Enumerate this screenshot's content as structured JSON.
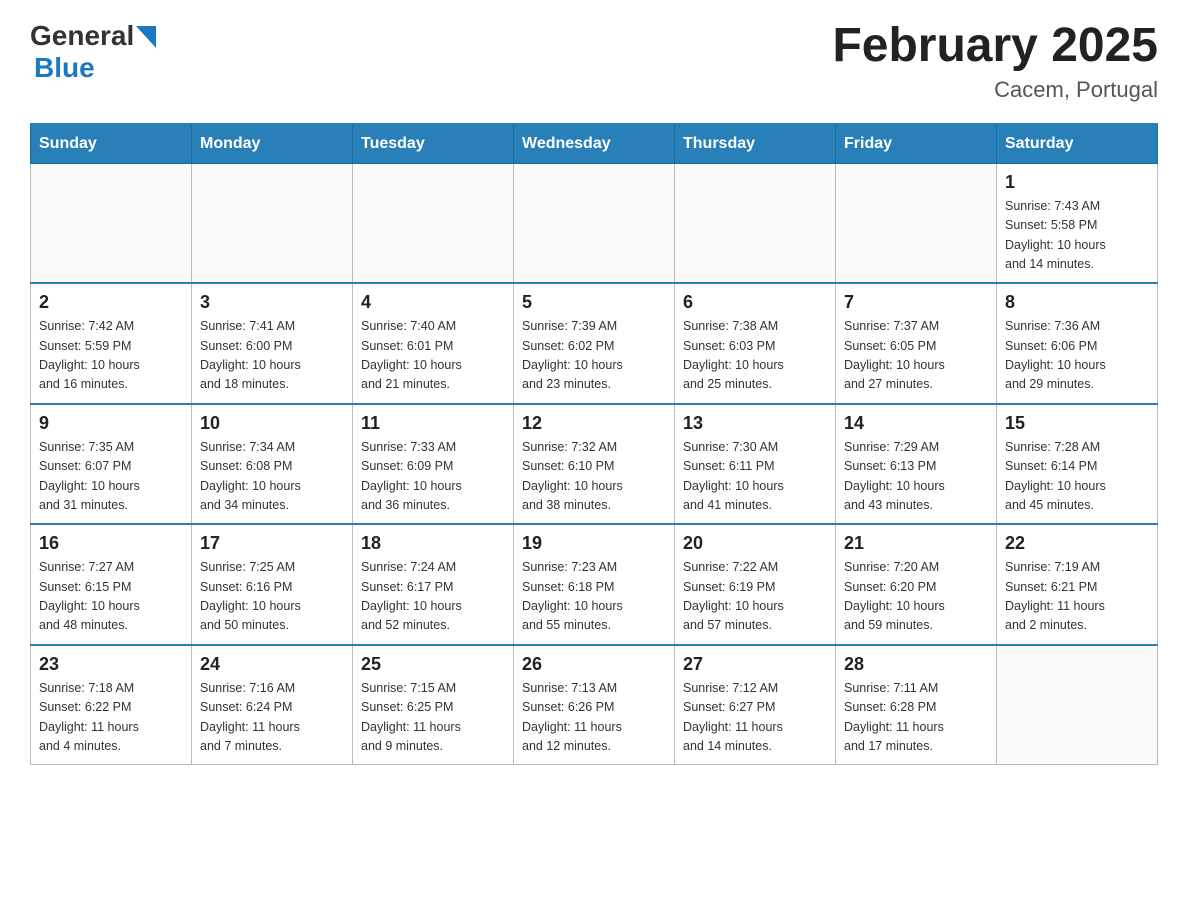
{
  "header": {
    "logo_general": "General",
    "logo_blue": "Blue",
    "month_title": "February 2025",
    "location": "Cacem, Portugal"
  },
  "days_of_week": [
    "Sunday",
    "Monday",
    "Tuesday",
    "Wednesday",
    "Thursday",
    "Friday",
    "Saturday"
  ],
  "weeks": [
    [
      {
        "day": "",
        "info": ""
      },
      {
        "day": "",
        "info": ""
      },
      {
        "day": "",
        "info": ""
      },
      {
        "day": "",
        "info": ""
      },
      {
        "day": "",
        "info": ""
      },
      {
        "day": "",
        "info": ""
      },
      {
        "day": "1",
        "info": "Sunrise: 7:43 AM\nSunset: 5:58 PM\nDaylight: 10 hours\nand 14 minutes."
      }
    ],
    [
      {
        "day": "2",
        "info": "Sunrise: 7:42 AM\nSunset: 5:59 PM\nDaylight: 10 hours\nand 16 minutes."
      },
      {
        "day": "3",
        "info": "Sunrise: 7:41 AM\nSunset: 6:00 PM\nDaylight: 10 hours\nand 18 minutes."
      },
      {
        "day": "4",
        "info": "Sunrise: 7:40 AM\nSunset: 6:01 PM\nDaylight: 10 hours\nand 21 minutes."
      },
      {
        "day": "5",
        "info": "Sunrise: 7:39 AM\nSunset: 6:02 PM\nDaylight: 10 hours\nand 23 minutes."
      },
      {
        "day": "6",
        "info": "Sunrise: 7:38 AM\nSunset: 6:03 PM\nDaylight: 10 hours\nand 25 minutes."
      },
      {
        "day": "7",
        "info": "Sunrise: 7:37 AM\nSunset: 6:05 PM\nDaylight: 10 hours\nand 27 minutes."
      },
      {
        "day": "8",
        "info": "Sunrise: 7:36 AM\nSunset: 6:06 PM\nDaylight: 10 hours\nand 29 minutes."
      }
    ],
    [
      {
        "day": "9",
        "info": "Sunrise: 7:35 AM\nSunset: 6:07 PM\nDaylight: 10 hours\nand 31 minutes."
      },
      {
        "day": "10",
        "info": "Sunrise: 7:34 AM\nSunset: 6:08 PM\nDaylight: 10 hours\nand 34 minutes."
      },
      {
        "day": "11",
        "info": "Sunrise: 7:33 AM\nSunset: 6:09 PM\nDaylight: 10 hours\nand 36 minutes."
      },
      {
        "day": "12",
        "info": "Sunrise: 7:32 AM\nSunset: 6:10 PM\nDaylight: 10 hours\nand 38 minutes."
      },
      {
        "day": "13",
        "info": "Sunrise: 7:30 AM\nSunset: 6:11 PM\nDaylight: 10 hours\nand 41 minutes."
      },
      {
        "day": "14",
        "info": "Sunrise: 7:29 AM\nSunset: 6:13 PM\nDaylight: 10 hours\nand 43 minutes."
      },
      {
        "day": "15",
        "info": "Sunrise: 7:28 AM\nSunset: 6:14 PM\nDaylight: 10 hours\nand 45 minutes."
      }
    ],
    [
      {
        "day": "16",
        "info": "Sunrise: 7:27 AM\nSunset: 6:15 PM\nDaylight: 10 hours\nand 48 minutes."
      },
      {
        "day": "17",
        "info": "Sunrise: 7:25 AM\nSunset: 6:16 PM\nDaylight: 10 hours\nand 50 minutes."
      },
      {
        "day": "18",
        "info": "Sunrise: 7:24 AM\nSunset: 6:17 PM\nDaylight: 10 hours\nand 52 minutes."
      },
      {
        "day": "19",
        "info": "Sunrise: 7:23 AM\nSunset: 6:18 PM\nDaylight: 10 hours\nand 55 minutes."
      },
      {
        "day": "20",
        "info": "Sunrise: 7:22 AM\nSunset: 6:19 PM\nDaylight: 10 hours\nand 57 minutes."
      },
      {
        "day": "21",
        "info": "Sunrise: 7:20 AM\nSunset: 6:20 PM\nDaylight: 10 hours\nand 59 minutes."
      },
      {
        "day": "22",
        "info": "Sunrise: 7:19 AM\nSunset: 6:21 PM\nDaylight: 11 hours\nand 2 minutes."
      }
    ],
    [
      {
        "day": "23",
        "info": "Sunrise: 7:18 AM\nSunset: 6:22 PM\nDaylight: 11 hours\nand 4 minutes."
      },
      {
        "day": "24",
        "info": "Sunrise: 7:16 AM\nSunset: 6:24 PM\nDaylight: 11 hours\nand 7 minutes."
      },
      {
        "day": "25",
        "info": "Sunrise: 7:15 AM\nSunset: 6:25 PM\nDaylight: 11 hours\nand 9 minutes."
      },
      {
        "day": "26",
        "info": "Sunrise: 7:13 AM\nSunset: 6:26 PM\nDaylight: 11 hours\nand 12 minutes."
      },
      {
        "day": "27",
        "info": "Sunrise: 7:12 AM\nSunset: 6:27 PM\nDaylight: 11 hours\nand 14 minutes."
      },
      {
        "day": "28",
        "info": "Sunrise: 7:11 AM\nSunset: 6:28 PM\nDaylight: 11 hours\nand 17 minutes."
      },
      {
        "day": "",
        "info": ""
      }
    ]
  ]
}
